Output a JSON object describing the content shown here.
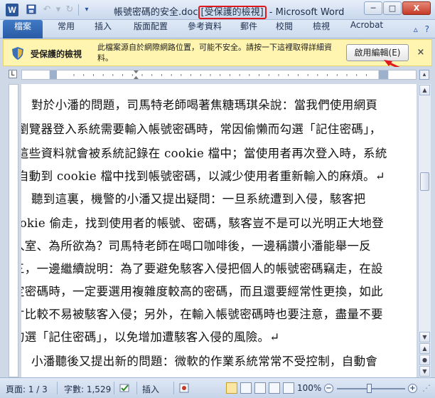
{
  "window": {
    "title_prefix": "帳號密碼的安全.doc",
    "title_highlight": "[受保護的檢視]",
    "title_suffix": " - Microsoft Word",
    "app_icon": "W",
    "min_label": "─",
    "max_label": "□",
    "close_label": "X"
  },
  "quick_access": {
    "save_icon": "save-icon",
    "undo_icon": "undo-icon",
    "redo_icon": "redo-icon",
    "customize_icon": "customize-icon"
  },
  "tabs": [
    "檔案",
    "常用",
    "插入",
    "版面配置",
    "參考資料",
    "郵件",
    "校閱",
    "檢視",
    "Acrobat"
  ],
  "protected_view": {
    "title": "受保護的檢視",
    "message": "此檔案源自於網際網路位置，可能不安全。請按一下這裡取得詳細資料。",
    "enable_button": "啟用編輯(E)",
    "close_label": "×",
    "accent_color": "#fff4b0"
  },
  "document": {
    "lines": [
      "對於小潘的問題，司馬特老師喝著焦糖瑪琪朵說：當我們使用網頁",
      "瀏覽器登入系統需要輸入帳號密碼時，常因偷懶而勾選「記住密碼」，",
      "這些資料就會被系統記錄在 cookie 檔中；當使用者再次登入時，系統",
      "自動到 cookie 檔中找到帳號密碼，以減少使用者重新輸入的麻煩。↵",
      "聽到這裏，機警的小潘又提出疑問：一旦系統遭到入侵，駭客把",
      "cookie 偷走，找到使用者的帳號、密碼，駭客豈不是可以光明正大地登",
      "入室、為所欲為？司馬特老師在喝口咖啡後，一邊稱讚小潘能舉一反",
      "三，一邊繼續說明：為了要避免駭客入侵把個人的帳號密碼竊走，在設",
      "定密碼時，一定要選用複雜度較高的密碼，而且還要經常性更換，如此",
      "才比較不易被駭客入侵；另外，在輸入帳號密碼時也要注意，盡量不要",
      "勾選「記住密碼」，以免增加遭駭客入侵的風險。↵",
      "小潘聽後又提出新的問題：微軟的作業系統常常不受控制，自動會"
    ]
  },
  "status_bar": {
    "page": "頁面: 1 / 3",
    "words": "字數: 1,529",
    "mode": "插入",
    "zoom": "100%",
    "zoom_minus": "−",
    "zoom_plus": "+"
  }
}
